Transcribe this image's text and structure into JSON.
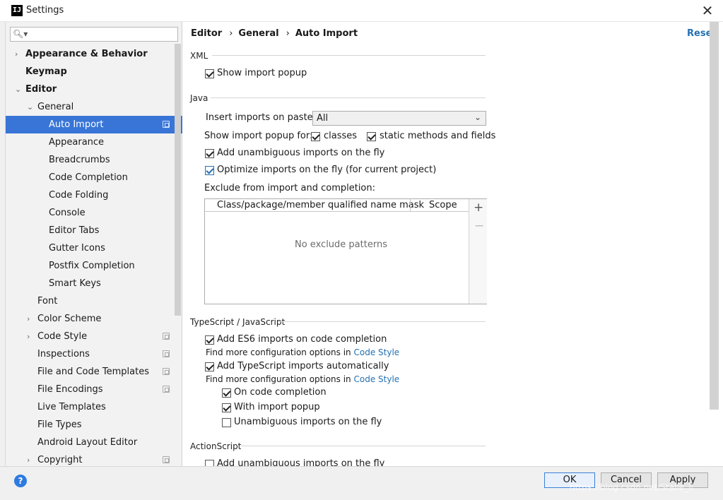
{
  "window": {
    "title": "Settings",
    "app_icon": "IJ"
  },
  "search": {
    "placeholder": ""
  },
  "tree": [
    {
      "label": "Appearance & Behavior",
      "bold": true,
      "arrow": "›"
    },
    {
      "label": "Keymap",
      "bold": true
    },
    {
      "label": "Editor",
      "bold": true,
      "arrow": "⌄"
    },
    {
      "label": "General",
      "arrow": "⌄"
    },
    {
      "label": "Auto Import",
      "selected": true
    },
    {
      "label": "Appearance"
    },
    {
      "label": "Breadcrumbs"
    },
    {
      "label": "Code Completion"
    },
    {
      "label": "Code Folding"
    },
    {
      "label": "Console"
    },
    {
      "label": "Editor Tabs"
    },
    {
      "label": "Gutter Icons"
    },
    {
      "label": "Postfix Completion"
    },
    {
      "label": "Smart Keys"
    },
    {
      "label": "Font"
    },
    {
      "label": "Color Scheme",
      "arrow": "›"
    },
    {
      "label": "Code Style",
      "arrow": "›"
    },
    {
      "label": "Inspections"
    },
    {
      "label": "File and Code Templates"
    },
    {
      "label": "File Encodings"
    },
    {
      "label": "Live Templates"
    },
    {
      "label": "File Types"
    },
    {
      "label": "Android Layout Editor"
    },
    {
      "label": "Copyright",
      "arrow": "›"
    }
  ],
  "breadcrumb": {
    "part1": "Editor",
    "part2": "General",
    "part3": "Auto Import",
    "sep": "›"
  },
  "reset_label": "Reset",
  "xml": {
    "section": "XML",
    "show_import_popup": "Show import popup"
  },
  "java": {
    "section": "Java",
    "insert_imports_label": "Insert imports on paste:",
    "insert_imports_value": "All",
    "show_popup_for_label": "Show import popup for:",
    "classes": "classes",
    "static_methods": "static methods and fields",
    "add_unambiguous": "Add unambiguous imports on the fly",
    "optimize_imports": "Optimize imports on the fly (for current project)",
    "exclude_label": "Exclude from import and completion:",
    "table_col1": "Class/package/member qualified name mask",
    "table_col2": "Scope",
    "table_empty": "No exclude patterns",
    "add_symbol": "+",
    "remove_symbol": "−"
  },
  "ts": {
    "section": "TypeScript / JavaScript",
    "add_es6": "Add ES6 imports on code completion",
    "find_more_1": "Find more configuration options in ",
    "code_style_link_1": "Code Style",
    "add_ts": "Add TypeScript imports automatically",
    "find_more_2": "Find more configuration options in ",
    "code_style_link_2": "Code Style",
    "on_completion": "On code completion",
    "with_popup": "With import popup",
    "unambiguous": "Unambiguous imports on the fly"
  },
  "actionscript": {
    "section": "ActionScript",
    "add_unambiguous": "Add unambiguous imports on the fly"
  },
  "footer": {
    "help": "?",
    "ok": "OK",
    "cancel": "Cancel",
    "apply": "Apply",
    "watermark": "https://blog.csdn.net/Stalle_li"
  },
  "colors": {
    "accent": "#3875d7",
    "link": "#2470b3"
  },
  "icons": {
    "close": "close-icon",
    "search": "search-icon",
    "help": "help-icon",
    "copy": "copy-icon"
  }
}
